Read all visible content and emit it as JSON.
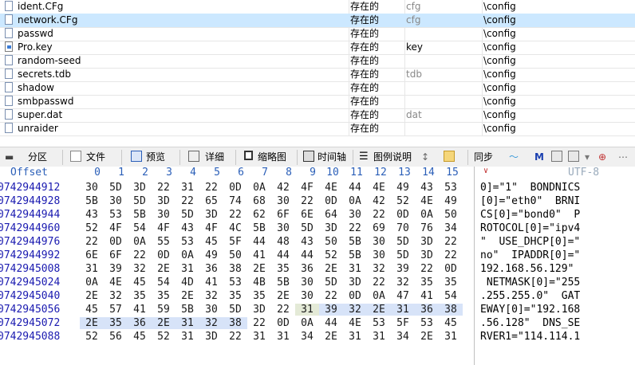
{
  "files": [
    {
      "name": "ident.CFg",
      "status": "存在的",
      "ext": "cfg",
      "path": "\\config",
      "selected": false,
      "icon": "file-icon"
    },
    {
      "name": "network.CFg",
      "status": "存在的",
      "ext": "cfg",
      "path": "\\config",
      "selected": true,
      "icon": "file-icon"
    },
    {
      "name": "passwd",
      "status": "存在的",
      "ext": "",
      "path": "\\config",
      "selected": false,
      "icon": "file-icon"
    },
    {
      "name": "Pro.key",
      "status": "存在的",
      "ext": "key",
      "path": "\\config",
      "selected": false,
      "icon": "key-file-icon"
    },
    {
      "name": "random-seed",
      "status": "存在的",
      "ext": "",
      "path": "\\config",
      "selected": false,
      "icon": "file-icon"
    },
    {
      "name": "secrets.tdb",
      "status": "存在的",
      "ext": "tdb",
      "path": "\\config",
      "selected": false,
      "icon": "file-icon"
    },
    {
      "name": "shadow",
      "status": "存在的",
      "ext": "",
      "path": "\\config",
      "selected": false,
      "icon": "file-icon"
    },
    {
      "name": "smbpasswd",
      "status": "存在的",
      "ext": "",
      "path": "\\config",
      "selected": false,
      "icon": "file-icon"
    },
    {
      "name": "super.dat",
      "status": "存在的",
      "ext": "dat",
      "path": "\\config",
      "selected": false,
      "icon": "file-icon"
    },
    {
      "name": "unraider",
      "status": "存在的",
      "ext": "",
      "path": "\\config",
      "selected": false,
      "icon": "file-icon"
    }
  ],
  "toolbar": {
    "partition": "分区",
    "file": "文件",
    "preview": "预览",
    "detail": "详细",
    "thumbnail": "缩略图",
    "timeline": "时间轴",
    "legend": "图例说明",
    "sync": "同步"
  },
  "hex": {
    "offset_label": "Offset",
    "columns": [
      "0",
      "1",
      "2",
      "3",
      "4",
      "5",
      "6",
      "7",
      "8",
      "9",
      "10",
      "11",
      "12",
      "13",
      "14",
      "15"
    ],
    "encoding": "UTF-8",
    "rows": [
      {
        "addr": "0742944912",
        "bytes": [
          "30",
          "5D",
          "3D",
          "22",
          "31",
          "22",
          "0D",
          "0A",
          "42",
          "4F",
          "4E",
          "44",
          "4E",
          "49",
          "43",
          "53"
        ],
        "text": "0]=\"1\"  BONDNICS"
      },
      {
        "addr": "0742944928",
        "bytes": [
          "5B",
          "30",
          "5D",
          "3D",
          "22",
          "65",
          "74",
          "68",
          "30",
          "22",
          "0D",
          "0A",
          "42",
          "52",
          "4E",
          "49"
        ],
        "text": "[0]=\"eth0\"  BRNI"
      },
      {
        "addr": "0742944944",
        "bytes": [
          "43",
          "53",
          "5B",
          "30",
          "5D",
          "3D",
          "22",
          "62",
          "6F",
          "6E",
          "64",
          "30",
          "22",
          "0D",
          "0A",
          "50"
        ],
        "text": "CS[0]=\"bond0\"  P"
      },
      {
        "addr": "0742944960",
        "bytes": [
          "52",
          "4F",
          "54",
          "4F",
          "43",
          "4F",
          "4C",
          "5B",
          "30",
          "5D",
          "3D",
          "22",
          "69",
          "70",
          "76",
          "34"
        ],
        "text": "ROTOCOL[0]=\"ipv4"
      },
      {
        "addr": "0742944976",
        "bytes": [
          "22",
          "0D",
          "0A",
          "55",
          "53",
          "45",
          "5F",
          "44",
          "48",
          "43",
          "50",
          "5B",
          "30",
          "5D",
          "3D",
          "22"
        ],
        "text": "\"  USE_DHCP[0]=\""
      },
      {
        "addr": "0742944992",
        "bytes": [
          "6E",
          "6F",
          "22",
          "0D",
          "0A",
          "49",
          "50",
          "41",
          "44",
          "44",
          "52",
          "5B",
          "30",
          "5D",
          "3D",
          "22"
        ],
        "text": "no\"  IPADDR[0]=\""
      },
      {
        "addr": "0742945008",
        "bytes": [
          "31",
          "39",
          "32",
          "2E",
          "31",
          "36",
          "38",
          "2E",
          "35",
          "36",
          "2E",
          "31",
          "32",
          "39",
          "22",
          "0D"
        ],
        "text": "192.168.56.129\""
      },
      {
        "addr": "0742945024",
        "bytes": [
          "0A",
          "4E",
          "45",
          "54",
          "4D",
          "41",
          "53",
          "4B",
          "5B",
          "30",
          "5D",
          "3D",
          "22",
          "32",
          "35",
          "35"
        ],
        "text": " NETMASK[0]=\"255"
      },
      {
        "addr": "0742945040",
        "bytes": [
          "2E",
          "32",
          "35",
          "35",
          "2E",
          "32",
          "35",
          "35",
          "2E",
          "30",
          "22",
          "0D",
          "0A",
          "47",
          "41",
          "54"
        ],
        "text": ".255.255.0\"  GAT"
      },
      {
        "addr": "0742945056",
        "bytes": [
          "45",
          "57",
          "41",
          "59",
          "5B",
          "30",
          "5D",
          "3D",
          "22",
          "31",
          "39",
          "32",
          "2E",
          "31",
          "36",
          "38"
        ],
        "text": "EWAY[0]=\"192.168"
      },
      {
        "addr": "0742945072",
        "bytes": [
          "2E",
          "35",
          "36",
          "2E",
          "31",
          "32",
          "38",
          "22",
          "0D",
          "0A",
          "44",
          "4E",
          "53",
          "5F",
          "53",
          "45"
        ],
        "text": ".56.128\"  DNS_SE"
      },
      {
        "addr": "0742945088",
        "bytes": [
          "52",
          "56",
          "45",
          "52",
          "31",
          "3D",
          "22",
          "31",
          "31",
          "34",
          "2E",
          "31",
          "31",
          "34",
          "2E",
          "31"
        ],
        "text": "RVER1=\"114.114.1"
      }
    ]
  }
}
